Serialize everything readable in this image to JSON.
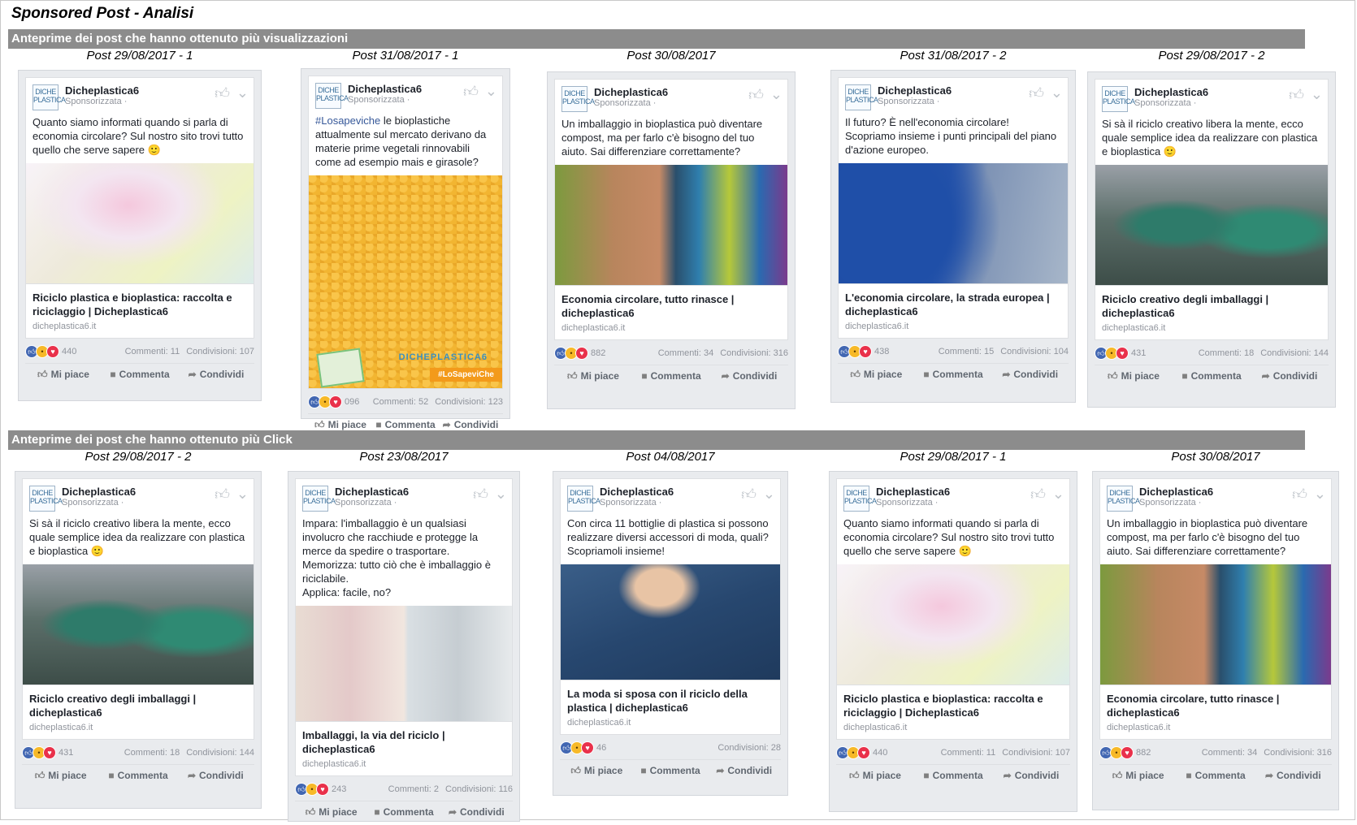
{
  "title": "Sponsored Post - Analisi",
  "sections": [
    {
      "title": "Anteprime dei post che hanno ottenuto più visualizzazioni"
    },
    {
      "title": "Anteprime dei post che hanno ottenuto più Click"
    }
  ],
  "common": {
    "page_name": "Dicheplastica6",
    "sponsored": "Sponsorizzata · ",
    "logo_text": "DICHE PLASTICA",
    "like": "Mi piace",
    "comment": "Comment​a",
    "share": "Condividi"
  },
  "posts_views": [
    {
      "label": "Post 29/08/2017 - 1",
      "text": "Quanto siamo informati quando si parla di economia circolare? Sul nostro sito trovi tutto quello che serve sapere 🙂",
      "link_title": "Riciclo plastica e bioplastica: raccolta e riciclaggio | Dicheplastica6",
      "domain": "dicheplastica6.it",
      "reactions_count": "440",
      "comments": "Commenti: 11",
      "shares": "Condivisioni: 107",
      "image": "plastic"
    },
    {
      "label": "Post 31/08/2017 - 1",
      "hashtag": "#Losapeviche",
      "text": " le bioplastiche attualmente sul mercato derivano da materie prime vegetali rinnovabili come ad esempio mais e girasole?",
      "badge_text": "#LoSapeviChe",
      "badge_logo": "DICHEPLASTICA6",
      "reactions_count": "096",
      "comments": "Commenti: 52",
      "shares": "Condivisioni: 123",
      "image": "corn"
    },
    {
      "label": "Post 30/08/2017",
      "text": "Un imballaggio in bioplastica può diventare compost, ma per farlo c'è bisogno del tuo aiuto. Sai differenziare correttamente?",
      "link_title": "Economia circolare, tutto rinasce | dicheplastica6",
      "domain": "dicheplastica6.it",
      "reactions_count": "882",
      "comments": "Commenti: 34",
      "shares": "Condivisioni: 316",
      "image": "eco"
    },
    {
      "label": "Post 31/08/2017 - 2",
      "text": "Il futuro? È nell'economia circolare! Scopriamo insieme i punti principali del piano d'azione europeo.",
      "link_title": "L'economia circolare, la strada europea | dicheplastica6",
      "domain": "dicheplastica6.it",
      "reactions_count": "438",
      "comments": "Commenti: 15",
      "shares": "Condivisioni: 104",
      "image": "eu"
    },
    {
      "label": "Post 29/08/2017 - 2",
      "text": "Si sà il riciclo creativo libera la mente, ecco quale semplice idea da realizzare con plastica e bioplastica 🙂",
      "link_title": "Riciclo creativo degli imballaggi | dicheplastica6",
      "domain": "dicheplastica6.it",
      "reactions_count": "431",
      "comments": "Commenti: 18",
      "shares": "Condivisioni: 144",
      "image": "bottles"
    }
  ],
  "posts_clicks": [
    {
      "label": "Post 29/08/2017 - 2",
      "text": "Si sà il riciclo creativo libera la mente, ecco quale semplice idea da realizzare con plastica e bioplastica 🙂",
      "link_title": "Riciclo creativo degli imballaggi | dicheplastica6",
      "domain": "dicheplastica6.it",
      "reactions_count": "431",
      "comments": "Commenti: 18",
      "shares": "Condivisioni: 144",
      "image": "bottles"
    },
    {
      "label": "Post 23/08/2017",
      "text": "Impara: l'imballaggio è un qualsiasi involucro che racchiude e protegge la merce da spedire o trasportare.\nMemorizza: tutto ciò che è imballaggio è riciclabile.\nApplica: facile, no?",
      "link_title": "Imballaggi, la via del riciclo | dicheplastica6",
      "domain": "dicheplastica6.it",
      "reactions_count": "243",
      "comments": "Commenti: 2",
      "shares": "Condivisioni: 116",
      "image": "pack"
    },
    {
      "label": "Post 04/08/2017",
      "text": "Con circa 11 bottiglie di plastica si possono realizzare diversi accessori di moda, quali? Scopriamoli insieme!",
      "link_title": "La moda si sposa con il riciclo della plastica | dicheplastica6",
      "domain": "dicheplastica6.it",
      "reactions_count": "46",
      "comments": "",
      "shares": "Condivisioni: 28",
      "image": "moda"
    },
    {
      "label": "Post 29/08/2017 - 1",
      "text": "Quanto siamo informati quando si parla di economia circolare? Sul nostro sito trovi tutto quello che serve sapere 🙂",
      "link_title": "Riciclo plastica e bioplastica: raccolta e riciclaggio | Dicheplastica6",
      "domain": "dicheplastica6.it",
      "reactions_count": "440",
      "comments": "Commenti: 11",
      "shares": "Condivisioni: 107",
      "image": "plastic"
    },
    {
      "label": "Post 30/08/2017",
      "text": "Un imballaggio in bioplastica può diventare compost, ma per farlo c'è bisogno del tuo aiuto. Sai differenziare correttamente?",
      "link_title": "Economia circolare, tutto rinasce | dicheplastica6",
      "domain": "dicheplastica6.it",
      "reactions_count": "882",
      "comments": "Commenti: 34",
      "shares": "Condivisioni: 316",
      "image": "eco"
    }
  ]
}
